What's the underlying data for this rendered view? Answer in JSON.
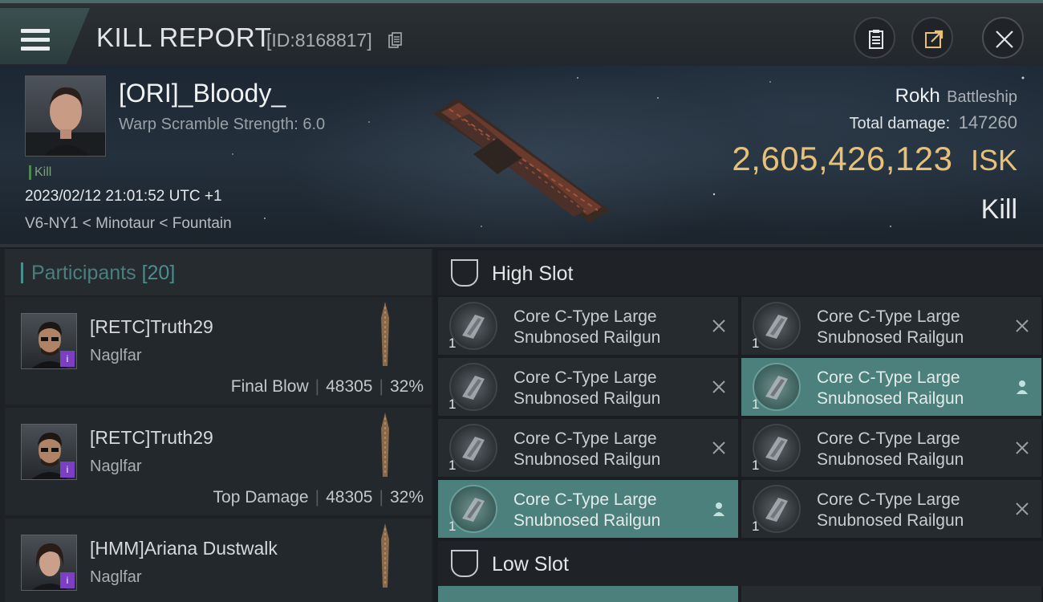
{
  "header": {
    "title": "KILL REPORT",
    "id_label": "[ID:8168817]"
  },
  "victim": {
    "name": "[ORI]_Bloody_",
    "warp_scramble": "Warp Scramble Strength: 6.0",
    "kill_tag": "Kill",
    "timestamp": "2023/02/12 21:01:52 UTC +1",
    "location": "V6-NY1 < Minotaur < Fountain",
    "ship_name": "Rokh",
    "ship_class": "Battleship",
    "total_damage_label": "Total damage:",
    "total_damage_value": "147260",
    "isk_value": "2,605,426,123",
    "isk_unit": "ISK",
    "result": "Kill"
  },
  "participants": {
    "title": "Participants",
    "count": "[20]",
    "rows": [
      {
        "name": "[RETC]Truth29",
        "ship": "Naglfar",
        "role": "Final Blow",
        "damage": "48305",
        "percent": "32%"
      },
      {
        "name": "[RETC]Truth29",
        "ship": "Naglfar",
        "role": "Top Damage",
        "damage": "48305",
        "percent": "32%"
      },
      {
        "name": "[HMM]Ariana Dustwalk",
        "ship": "Naglfar"
      }
    ]
  },
  "fitting": {
    "high_slot": {
      "title": "High Slot",
      "items": [
        {
          "qty": "1",
          "name": "Core C-Type Large Snubnosed Railgun",
          "status": "destroyed"
        },
        {
          "qty": "1",
          "name": "Core C-Type Large Snubnosed Railgun",
          "status": "destroyed"
        },
        {
          "qty": "1",
          "name": "Core C-Type Large Snubnosed Railgun",
          "status": "destroyed"
        },
        {
          "qty": "1",
          "name": "Core C-Type Large Snubnosed Railgun",
          "status": "dropped"
        },
        {
          "qty": "1",
          "name": "Core C-Type Large Snubnosed Railgun",
          "status": "destroyed"
        },
        {
          "qty": "1",
          "name": "Core C-Type Large Snubnosed Railgun",
          "status": "destroyed"
        },
        {
          "qty": "1",
          "name": "Core C-Type Large Snubnosed Railgun",
          "status": "dropped"
        },
        {
          "qty": "1",
          "name": "Core C-Type Large Snubnosed Railgun",
          "status": "destroyed"
        }
      ]
    },
    "low_slot": {
      "title": "Low Slot"
    }
  },
  "icons": {
    "menu": "menu-icon",
    "copy": "copy-icon",
    "clipboard": "clipboard-icon",
    "share": "share-icon",
    "close": "close-icon",
    "destroyed": "x-icon",
    "dropped": "person-icon"
  },
  "colors": {
    "accent_teal": "#4a8e8f",
    "isk_gold": "#e8c178",
    "dropped_highlight": "#4b807c",
    "alliance_badge": "#7b3fc4"
  }
}
